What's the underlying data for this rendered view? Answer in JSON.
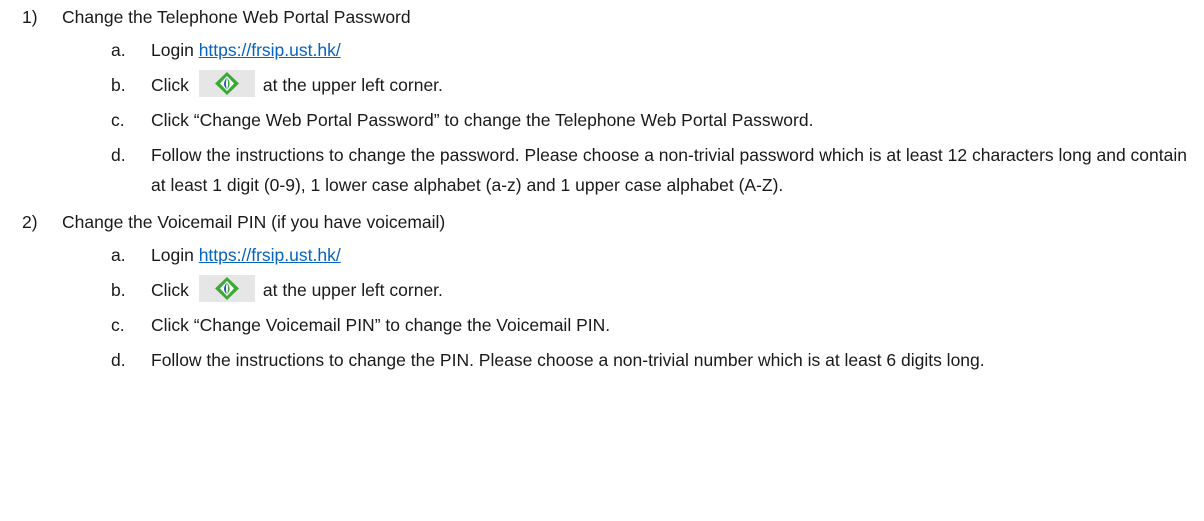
{
  "sections": [
    {
      "number": "1)",
      "title": "Change the Telephone Web Portal Password",
      "steps": {
        "a": {
          "letter": "a.",
          "prefix": "Login",
          "link": "https://frsip.ust.hk/"
        },
        "b": {
          "letter": "b.",
          "prefix": "Click",
          "suffix": "at the upper left corner.",
          "icon": "portal-logo-icon"
        },
        "c": {
          "letter": "c.",
          "text": "Click “Change Web Portal Password” to change the Telephone Web Portal Password."
        },
        "d": {
          "letter": "d.",
          "text": "Follow the instructions to change the password. Please choose a non-trivial password which is at least 12 characters long and contain at least 1 digit (0-9), 1 lower case alphabet (a-z) and 1 upper case alphabet (A-Z)."
        }
      }
    },
    {
      "number": "2)",
      "title": "Change the Voicemail PIN (if you have voicemail)",
      "steps": {
        "a": {
          "letter": "a.",
          "prefix": "Login",
          "link": "https://frsip.ust.hk/"
        },
        "b": {
          "letter": "b.",
          "prefix": "Click",
          "suffix": "at the upper left corner.",
          "icon": "portal-logo-icon"
        },
        "c": {
          "letter": "c.",
          "text": "Click “Change Voicemail PIN” to change the Voicemail PIN."
        },
        "d": {
          "letter": "d.",
          "text": "Follow the instructions to change the PIN. Please choose a non-trivial number which is at least 6 digits long."
        }
      }
    }
  ],
  "colors": {
    "link": "#0563c1",
    "text": "#1a1a1a",
    "icon_bg": "#e6e6e6",
    "icon_green": "#3aa935",
    "icon_blue": "#1f5fa8"
  }
}
